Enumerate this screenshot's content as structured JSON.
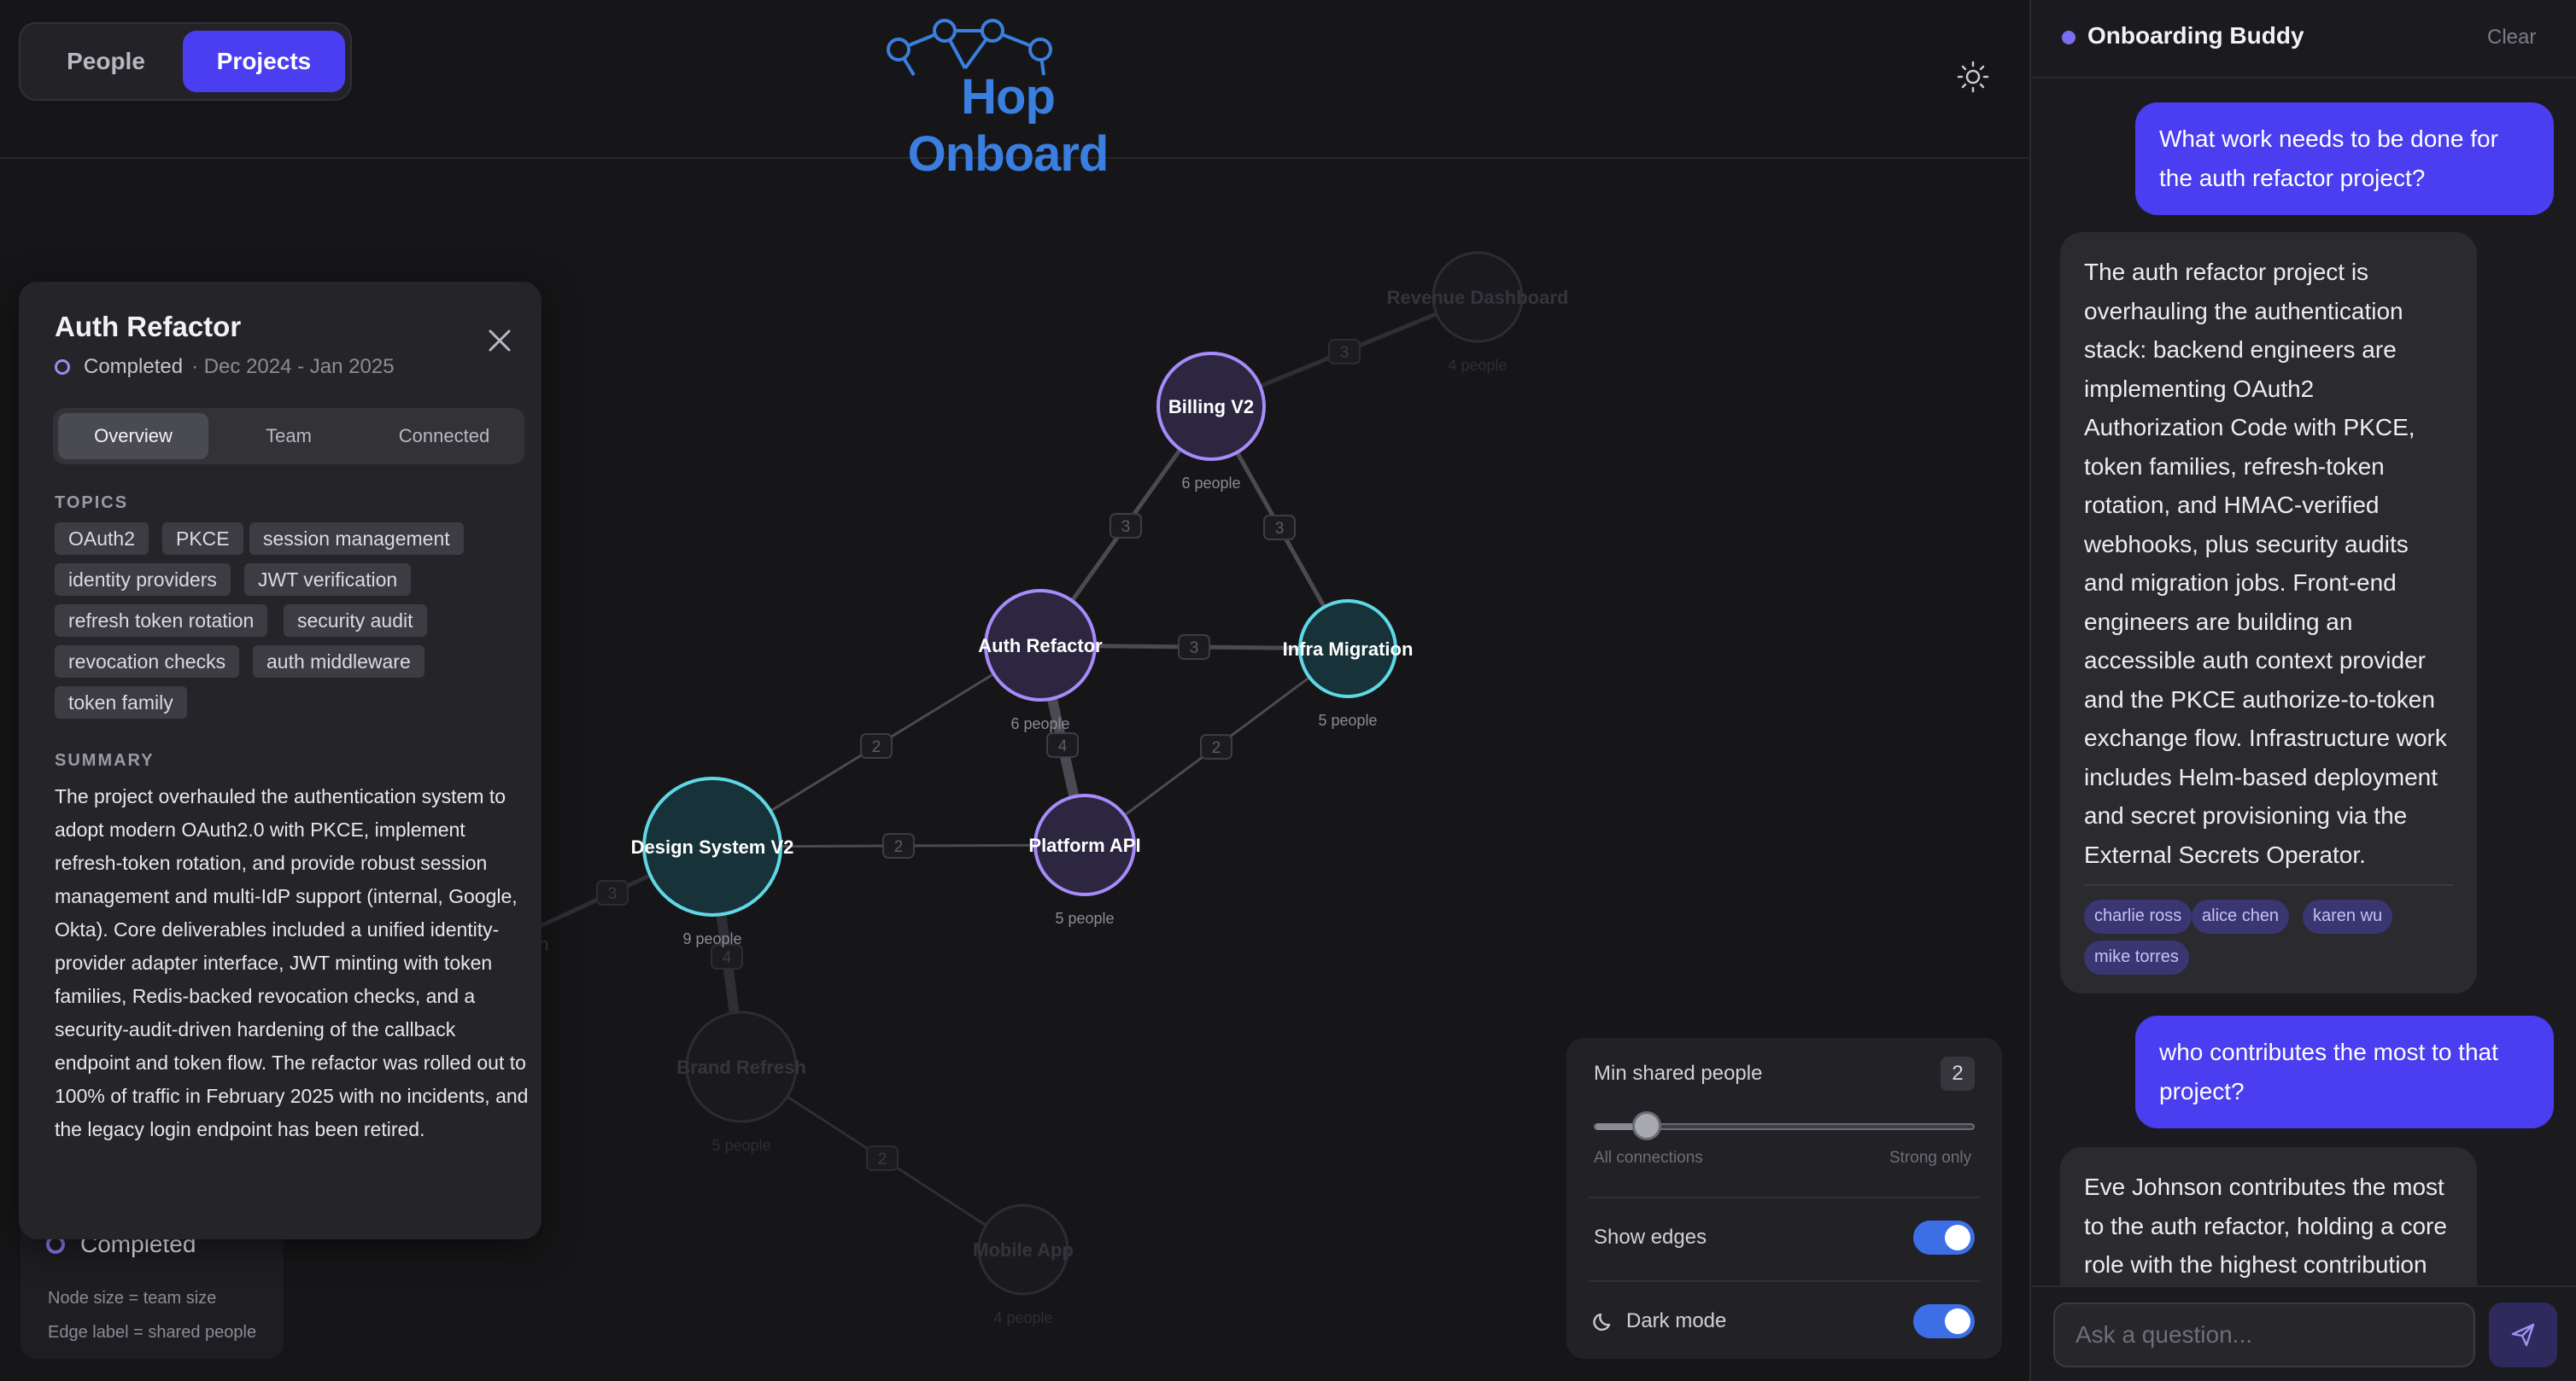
{
  "header": {
    "segments": [
      {
        "label": "People"
      },
      {
        "label": "Projects"
      }
    ],
    "logo_text": "Hop Onboard",
    "theme_icon": "sun-icon"
  },
  "graph": {
    "nodes": [
      {
        "id": "billing",
        "label": "Billing V2",
        "sub": "6 people",
        "color": "#a78bfa",
        "faded": false
      },
      {
        "id": "auth",
        "label": "Auth Refactor",
        "sub": "6 people",
        "color": "#a78bfa",
        "faded": false
      },
      {
        "id": "infra",
        "label": "Infra Migration",
        "sub": "5 people",
        "color": "#5fd8e6",
        "faded": false
      },
      {
        "id": "design",
        "label": "Design System V2",
        "sub": "9 people",
        "color": "#5fd8e6",
        "faded": false
      },
      {
        "id": "platform",
        "label": "Platform API",
        "sub": "5 people",
        "color": "#a78bfa",
        "faded": false
      },
      {
        "id": "revenue",
        "label": "Revenue Dashboard",
        "sub": "4 people",
        "color": "#8080a0",
        "faded": true
      },
      {
        "id": "brand",
        "label": "Brand Refresh",
        "sub": "5 people",
        "color": "#8080a0",
        "faded": true
      },
      {
        "id": "mobile",
        "label": "Mobile App",
        "sub": "4 people",
        "color": "#8080a0",
        "faded": true
      }
    ],
    "edges": [
      {
        "from": "billing",
        "to": "auth",
        "label": "3"
      },
      {
        "from": "billing",
        "to": "infra",
        "label": "3"
      },
      {
        "from": "auth",
        "to": "infra",
        "label": "3"
      },
      {
        "from": "auth",
        "to": "design",
        "label": "2"
      },
      {
        "from": "auth",
        "to": "platform",
        "label": "4"
      },
      {
        "from": "design",
        "to": "platform",
        "label": "2"
      },
      {
        "from": "infra",
        "to": "platform",
        "label": "2"
      },
      {
        "from": "billing",
        "to": "revenue",
        "label": "3"
      },
      {
        "from": "design",
        "to": "brand",
        "label": "4"
      },
      {
        "from": "brand",
        "to": "mobile",
        "label": "2"
      },
      {
        "from": "design",
        "to": "offscreen",
        "label": "3"
      }
    ],
    "cut_label": "gn"
  },
  "legend": {
    "status": "Completed",
    "note_size": "Node size = team size",
    "note_edge": "Edge label = shared people"
  },
  "panel": {
    "title": "Auth Refactor",
    "status": "Completed",
    "date": "· Dec 2024 - Jan 2025",
    "tabs": [
      "Overview",
      "Team",
      "Connected"
    ],
    "topics_heading": "TOPICS",
    "topics": [
      "OAuth2",
      "PKCE",
      "session management",
      "identity providers",
      "JWT verification",
      "refresh token rotation",
      "security audit",
      "revocation checks",
      "auth middleware",
      "token family"
    ],
    "summary_heading": "SUMMARY",
    "summary": "The project overhauled the authentication system to adopt modern OAuth2.0 with PKCE, implement refresh-token rotation, and provide robust session management and multi-IdP support (internal, Google, Okta). Core deliverables included a unified identity-provider adapter interface, JWT minting with token families, Redis-backed revocation checks, and a security-audit-driven hardening of the callback endpoint and token flow. The refactor was rolled out to 100% of traffic in February 2025 with no incidents, and the legacy login endpoint has been retired."
  },
  "controls": {
    "min_shared_label": "Min shared people",
    "min_shared_value": "2",
    "slider_fraction": 0.14,
    "slider_left": "All connections",
    "slider_right": "Strong only",
    "show_edges_label": "Show edges",
    "show_edges": true,
    "dark_mode_label": "Dark mode",
    "dark_mode": true
  },
  "chat": {
    "title": "Onboarding Buddy",
    "clear": "Clear",
    "messages": [
      {
        "role": "user",
        "text": "What work needs to be done for the auth refactor project?"
      },
      {
        "role": "bot",
        "text": "The auth refactor project is overhauling the authentication stack: backend engineers are implementing OAuth2 Authorization Code with PKCE, token families, refresh-token rotation, and HMAC-verified webhooks, plus security audits and migration jobs. Front-end engineers are building an accessible auth context provider and the PKCE authorize-to-token exchange flow. Infrastructure work includes Helm-based deployment and secret provisioning via the External Secrets Operator.",
        "tags": [
          "charlie ross",
          "alice chen",
          "karen wu",
          "mike torres"
        ]
      },
      {
        "role": "user",
        "text": "who contributes the most to that project?"
      },
      {
        "role": "bot",
        "text": "Eve Johnson contributes the most to the auth refactor, holding a core role with the highest contribution"
      }
    ],
    "input_placeholder": "Ask a question...",
    "input_value": "",
    "send_icon": "send-icon"
  }
}
